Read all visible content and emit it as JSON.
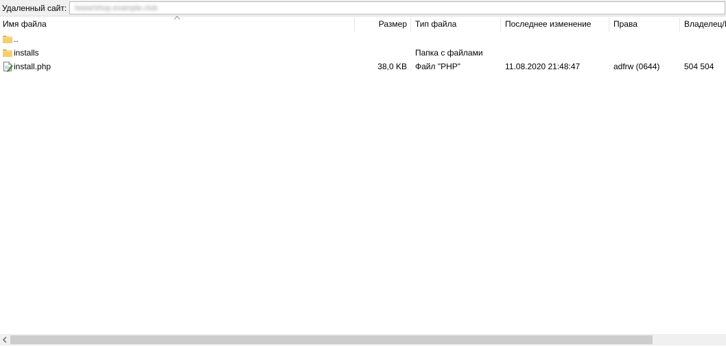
{
  "path_bar": {
    "label": "Удаленный сайт:",
    "path_value": "/www/shop.example.club"
  },
  "columns": {
    "name": "Имя файла",
    "size": "Размер",
    "type": "Тип файла",
    "modified": "Последнее изменение",
    "permissions": "Права",
    "owner": "Владелец/Группа"
  },
  "sort": {
    "column": "name",
    "direction": "ascending",
    "icon": "sort-up-arrow-icon"
  },
  "rows": [
    {
      "icon": "folder-icon",
      "name": "..",
      "size": "",
      "type": "",
      "modified": "",
      "permissions": "",
      "owner": ""
    },
    {
      "icon": "folder-icon",
      "name": "installs",
      "size": "",
      "type": "Папка с файлами",
      "modified": "",
      "permissions": "",
      "owner": ""
    },
    {
      "icon": "php-file-icon",
      "name": "install.php",
      "size": "38,0 KB",
      "type": "Файл \"PHP\"",
      "modified": "11.08.2020 21:48:47",
      "permissions": "adfrw (0644)",
      "owner": "504 504"
    }
  ],
  "scrollbar": {
    "left_arrow_icon": "chevron-left-icon"
  },
  "colors": {
    "folder": "#f5cf6a",
    "folder_dark": "#e0b24a",
    "toolbar_bg": "#f0f0f0",
    "scroll_thumb": "#cdcdcd"
  }
}
